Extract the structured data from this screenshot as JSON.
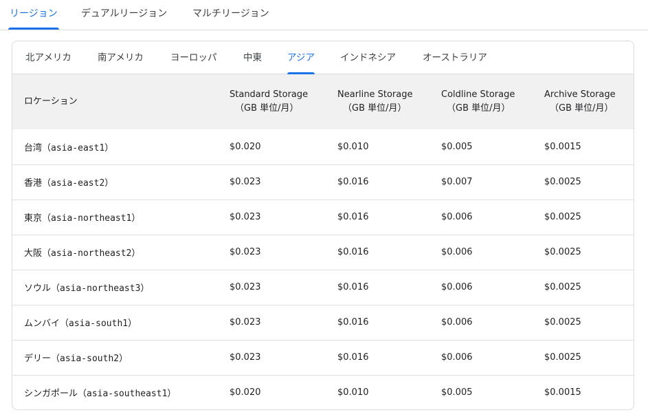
{
  "top_tabs": [
    {
      "label": "リージョン",
      "active": true
    },
    {
      "label": "デュアルリージョン",
      "active": false
    },
    {
      "label": "マルチリージョン",
      "active": false
    }
  ],
  "sub_tabs": [
    {
      "label": "北アメリカ",
      "active": false
    },
    {
      "label": "南アメリカ",
      "active": false
    },
    {
      "label": "ヨーロッパ",
      "active": false
    },
    {
      "label": "中東",
      "active": false
    },
    {
      "label": "アジア",
      "active": true
    },
    {
      "label": "インドネシア",
      "active": false
    },
    {
      "label": "オーストラリア",
      "active": false
    }
  ],
  "table": {
    "headers": [
      {
        "title": "ロケーション",
        "unit": ""
      },
      {
        "title": "Standard Storage",
        "unit": "（GB 単位/月）"
      },
      {
        "title": "Nearline Storage",
        "unit": "（GB 単位/月）"
      },
      {
        "title": "Coldline Storage",
        "unit": "（GB 単位/月）"
      },
      {
        "title": "Archive Storage",
        "unit": "（GB 単位/月）"
      }
    ],
    "rows": [
      {
        "location": "台湾（asia-east1）",
        "standard": "$0.020",
        "nearline": "$0.010",
        "coldline": "$0.005",
        "archive": "$0.0015"
      },
      {
        "location": "香港（asia-east2）",
        "standard": "$0.023",
        "nearline": "$0.016",
        "coldline": "$0.007",
        "archive": "$0.0025"
      },
      {
        "location": "東京（asia-northeast1）",
        "standard": "$0.023",
        "nearline": "$0.016",
        "coldline": "$0.006",
        "archive": "$0.0025"
      },
      {
        "location": "大阪（asia-northeast2）",
        "standard": "$0.023",
        "nearline": "$0.016",
        "coldline": "$0.006",
        "archive": "$0.0025"
      },
      {
        "location": "ソウル（asia-northeast3）",
        "standard": "$0.023",
        "nearline": "$0.016",
        "coldline": "$0.006",
        "archive": "$0.0025"
      },
      {
        "location": "ムンバイ（asia-south1）",
        "standard": "$0.023",
        "nearline": "$0.016",
        "coldline": "$0.006",
        "archive": "$0.0025"
      },
      {
        "location": "デリー（asia-south2）",
        "standard": "$0.023",
        "nearline": "$0.016",
        "coldline": "$0.006",
        "archive": "$0.0025"
      },
      {
        "location": "シンガポール（asia-southeast1）",
        "standard": "$0.020",
        "nearline": "$0.010",
        "coldline": "$0.005",
        "archive": "$0.0015"
      }
    ]
  },
  "colors": {
    "accent": "#1a73e8",
    "header_bg": "#f1f1f1",
    "border": "#dadce0"
  }
}
